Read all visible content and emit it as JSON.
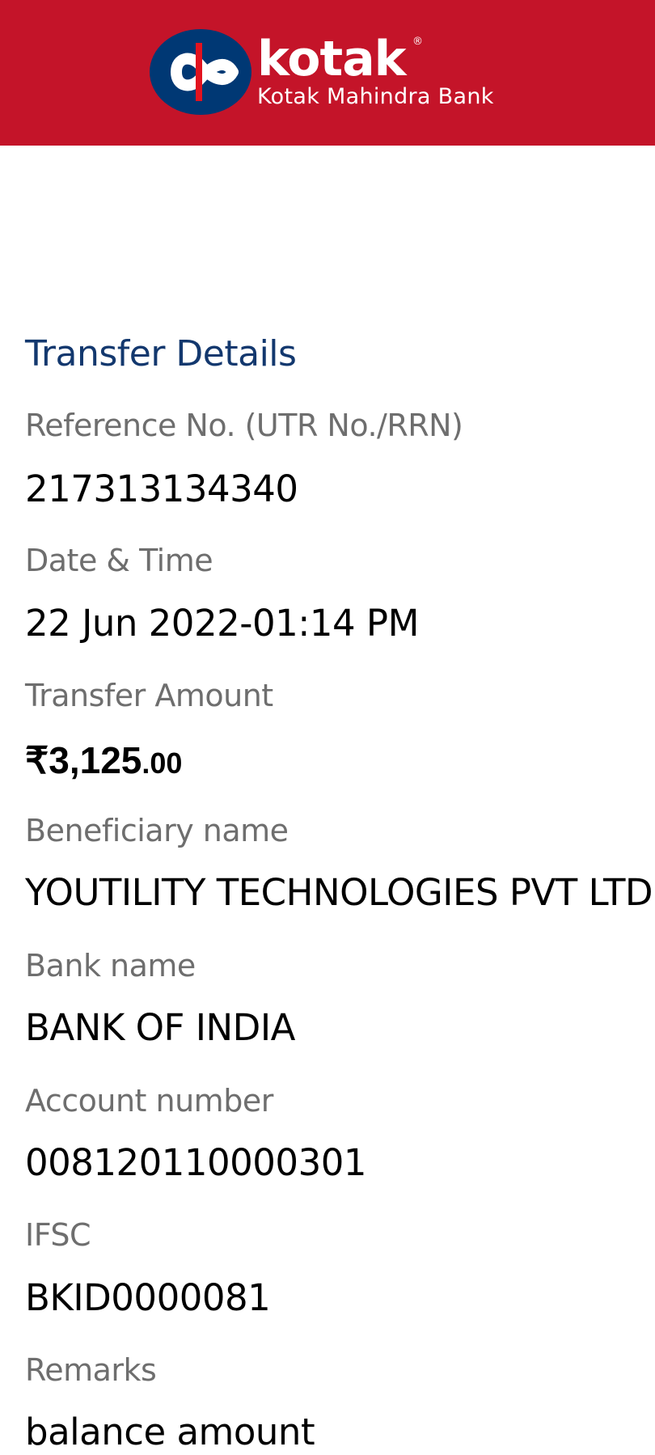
{
  "header": {
    "brand_name": "kotak",
    "registered_mark": "®",
    "brand_subtitle": "Kotak Mahindra Bank",
    "background_color": "#c41429",
    "logo_icon": "kotak-infinity-logo-icon"
  },
  "transfer": {
    "title": "Transfer Details",
    "reference_label": "Reference No. (UTR No./RRN)",
    "reference_value": "217313134340",
    "datetime_label": "Date & Time",
    "datetime_value": "22 Jun 2022-01:14 PM",
    "amount_label": "Transfer Amount",
    "amount_main": "₹3,125",
    "amount_paise": ".00",
    "beneficiary_label": "Beneficiary name",
    "beneficiary_value": "YOUTILITY TECHNOLOGIES PVT LTD",
    "bank_label": "Bank name",
    "bank_value": "BANK OF INDIA",
    "account_label": "Account number",
    "account_value": "008120110000301",
    "ifsc_label": "IFSC",
    "ifsc_value": "BKID0000081",
    "remarks_label": "Remarks",
    "remarks_value": "balance amount"
  }
}
